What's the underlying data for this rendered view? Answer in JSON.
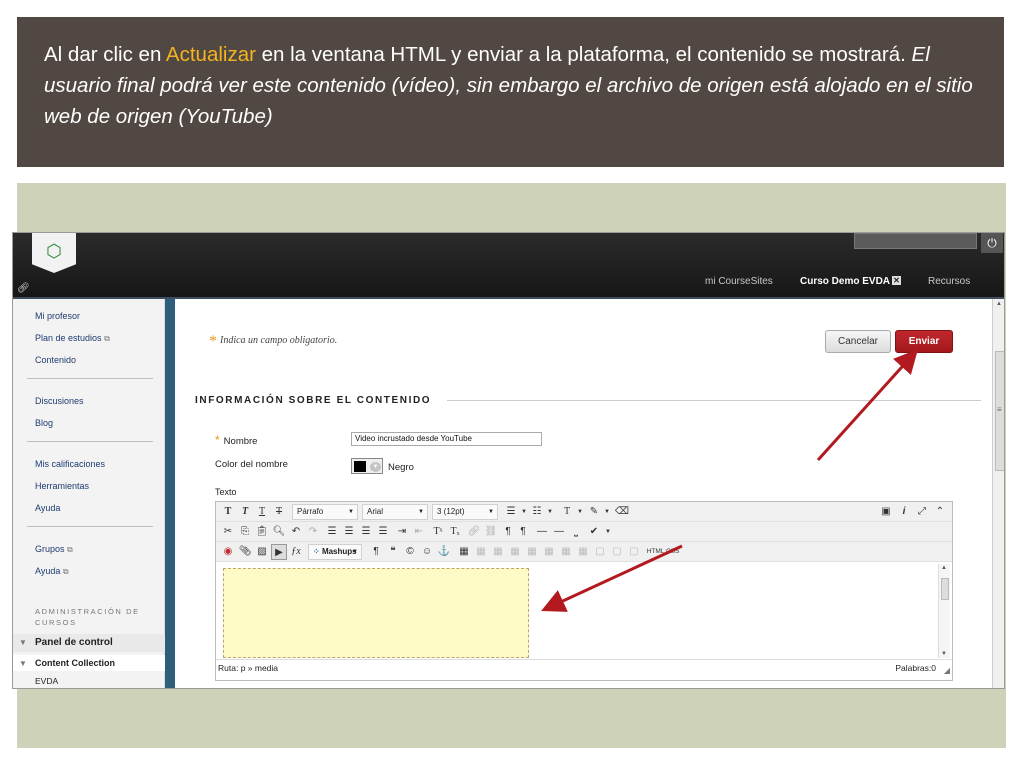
{
  "slide": {
    "caption": {
      "part1": "Al  dar clic en ",
      "highlight": "Actualizar",
      "part2": " en  la ventana HTML y enviar a la plataforma, el contenido se mostrará.  ",
      "italic": "El usuario final podrá ver este contenido (vídeo), sin embargo el archivo de origen  está alojado en el sitio web de origen (YouTube)"
    },
    "colors": {
      "banner": "#514844",
      "highlight": "#f5b31f",
      "panel": "#cdd2b9",
      "arrow": "#b21a1f"
    }
  },
  "header": {
    "tabs": [
      "mi CourseSites",
      "Curso Demo EVDA",
      "Recursos"
    ],
    "active_tab": "Curso Demo EVDA",
    "tab_close": "✕",
    "power_icon": "power-icon",
    "link_icon": "link-icon"
  },
  "sidebar": {
    "group1": [
      "Mi profesor",
      "Plan de estudios",
      "Contenido"
    ],
    "group2": [
      "Discusiones",
      "Blog"
    ],
    "group3": [
      "Mis calificaciones",
      "Herramientas",
      "Ayuda"
    ],
    "group4": [
      "Grupos",
      "Ayuda"
    ],
    "admin_title": "ADMINISTRACIÓN DE CURSOS",
    "control_panel": "Panel de control",
    "content_collection": "Content Collection",
    "evda": "EVDA"
  },
  "form": {
    "required_note": "Indica un campo obligatorio.",
    "cancel_label": "Cancelar",
    "submit_label": "Enviar",
    "section_title": "INFORMACIÓN SOBRE EL CONTENIDO",
    "name_label": "Nombre",
    "name_value": "Video incrustado desde YouTube",
    "color_label": "Color del nombre",
    "color_value": "Negro",
    "text_label": "Texto"
  },
  "editor": {
    "paragraph": "Párrafo",
    "font": "Arial",
    "size": "3 (12pt)",
    "mashups": "Mashups",
    "path_label": "Ruta: ",
    "path_value": "p » media",
    "words": "Palabras:0",
    "html_css": "HTML CSS"
  }
}
